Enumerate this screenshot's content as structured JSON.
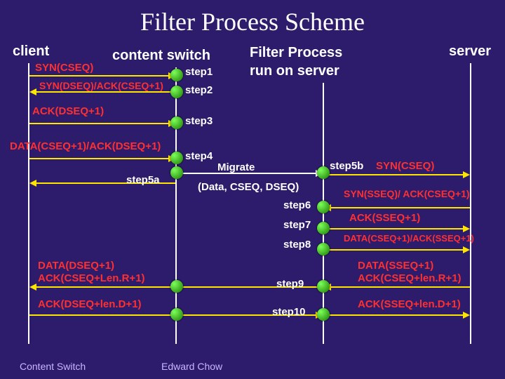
{
  "title": "Filter Process Scheme",
  "headers": {
    "client": "client",
    "switch": "content switch",
    "filter": "Filter Process",
    "filter2": "run on server",
    "server": "server"
  },
  "left": {
    "m1": "SYN(CSEQ)",
    "m2": "SYN(DSEQ)/ACK(CSEQ+1)",
    "m3": "ACK(DSEQ+1)",
    "m4": "DATA(CSEQ+1)/ACK(DSEQ+1)",
    "m5": "DATA(DSEQ+1)",
    "m6": "ACK(CSEQ+Len.R+1)",
    "m7": "ACK(DSEQ+len.D+1)"
  },
  "mid": {
    "migrate1": "Migrate",
    "migrate2": "(Data, CSEQ, DSEQ)"
  },
  "right": {
    "r1": "SYN(CSEQ)",
    "r2": "SYN(SSEQ)/ ACK(CSEQ+1)",
    "r3": "ACK(SSEQ+1)",
    "r4": "DATA(CSEQ+1)/ACK(SSEQ+1)",
    "r5": "DATA(SSEQ+1)",
    "r6": "ACK(CSEQ+len.R+1)",
    "r7": "ACK(SSEQ+len.D+1)"
  },
  "steps": {
    "s1": "step1",
    "s2": "step2",
    "s3": "step3",
    "s4": "step4",
    "s5a": "step5a",
    "s5b": "step5b",
    "s6": "step6",
    "s7": "step7",
    "s8": "step8",
    "s9": "step9",
    "s10": "step10"
  },
  "footer": {
    "left": "Content Switch",
    "mid": "Edward Chow"
  }
}
